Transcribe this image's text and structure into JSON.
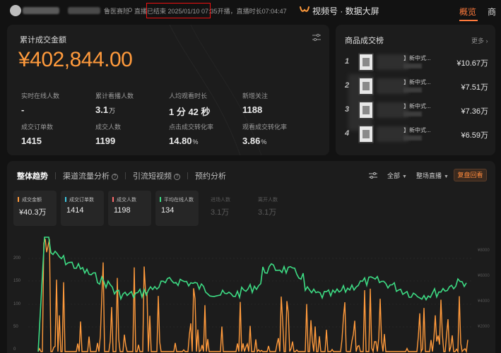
{
  "topbar": {
    "live_status": "直播已结束 2025/01/10 07:35开播，直播时长07:04:47",
    "account_suffix": "鲁医赛险",
    "brand": "视频号 · 数据大屏",
    "tab_active": "概览",
    "tab_partial": "商"
  },
  "sales": {
    "title": "累计成交金额",
    "amount": "¥402,844.00",
    "metrics": [
      {
        "label": "实时在线人数",
        "value": "-",
        "unit": ""
      },
      {
        "label": "累计看播人数",
        "value": "3.1",
        "unit": "万"
      },
      {
        "label": "人均观看时长",
        "value": "1 分 42 秒",
        "unit": ""
      },
      {
        "label": "新增关注",
        "value": "1188",
        "unit": ""
      },
      {
        "label": "成交订单数",
        "value": "1415",
        "unit": ""
      },
      {
        "label": "成交人数",
        "value": "1199",
        "unit": ""
      },
      {
        "label": "点击成交转化率",
        "value": "14.80",
        "unit": "%"
      },
      {
        "label": "观看成交转化率",
        "value": "3.86",
        "unit": "%"
      }
    ]
  },
  "ranking": {
    "title": "商品成交榜",
    "more": "更多 ›",
    "items": [
      {
        "rank": "1",
        "name": "】新中式...",
        "price": "¥10.67万"
      },
      {
        "rank": "2",
        "name": "】新中式...",
        "price": "¥7.51万"
      },
      {
        "rank": "3",
        "name": "】新中式...",
        "price": "¥7.36万"
      },
      {
        "rank": "4",
        "name": "】新中式...",
        "price": "¥6.59万"
      }
    ]
  },
  "trend": {
    "tabs": [
      "整体趋势",
      "渠道流量分析",
      "引流短视频",
      "预约分析"
    ],
    "filter_all": "全部",
    "scope": "整场直播",
    "replay": "复盘回看",
    "cards": [
      {
        "label": "成交金额",
        "value": "¥40.3万",
        "color": "#ff9a3c"
      },
      {
        "label": "成交订单数",
        "value": "1414",
        "color": "#3ec6e0"
      },
      {
        "label": "成交人数",
        "value": "1198",
        "color": "#ff6b6b"
      },
      {
        "label": "平均在线人数",
        "value": "134",
        "color": "#3ddc84"
      },
      {
        "label": "进场人数",
        "value": "3.1万",
        "color": ""
      },
      {
        "label": "离开人数",
        "value": "3.1万",
        "color": ""
      }
    ],
    "y_left": [
      "200",
      "150",
      "100",
      "50",
      "0"
    ],
    "y_right": [
      "¥8000",
      "¥6000",
      "¥4000",
      "¥2000"
    ]
  },
  "colors": {
    "accent": "#ff7a3c",
    "gmv_line": "#ff9a3c",
    "online_line": "#3ddc84"
  }
}
